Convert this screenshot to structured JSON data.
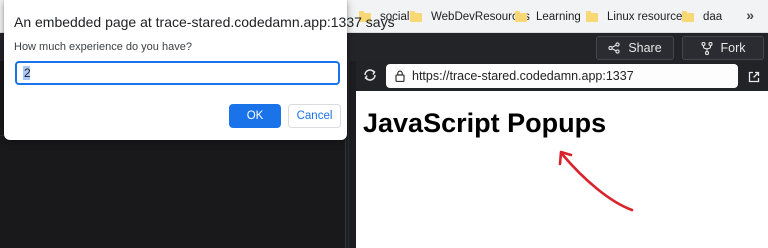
{
  "bookmarks": {
    "items": [
      {
        "label": "social",
        "icon": "folder-icon"
      },
      {
        "label": "WebDevResources",
        "icon": "folder-icon"
      },
      {
        "label": "Learning",
        "icon": "folder-icon"
      },
      {
        "label": "Linux resources",
        "icon": "folder-icon"
      },
      {
        "label": "daa",
        "icon": "folder-icon"
      }
    ],
    "more_label": "»"
  },
  "toolbar": {
    "share_label": "Share",
    "fork_label": "Fork"
  },
  "preview": {
    "url": "https://trace-stared.codedamn.app:1337",
    "heading": "JavaScript Popups",
    "annotation_color": "#d9232a"
  },
  "dialog": {
    "title": "An embedded page at trace-stared.codedamn.app:1337 says",
    "message": "How much experience do you have?",
    "input_value": "2",
    "ok_label": "OK",
    "cancel_label": "Cancel",
    "accent": "#1a73e8"
  }
}
